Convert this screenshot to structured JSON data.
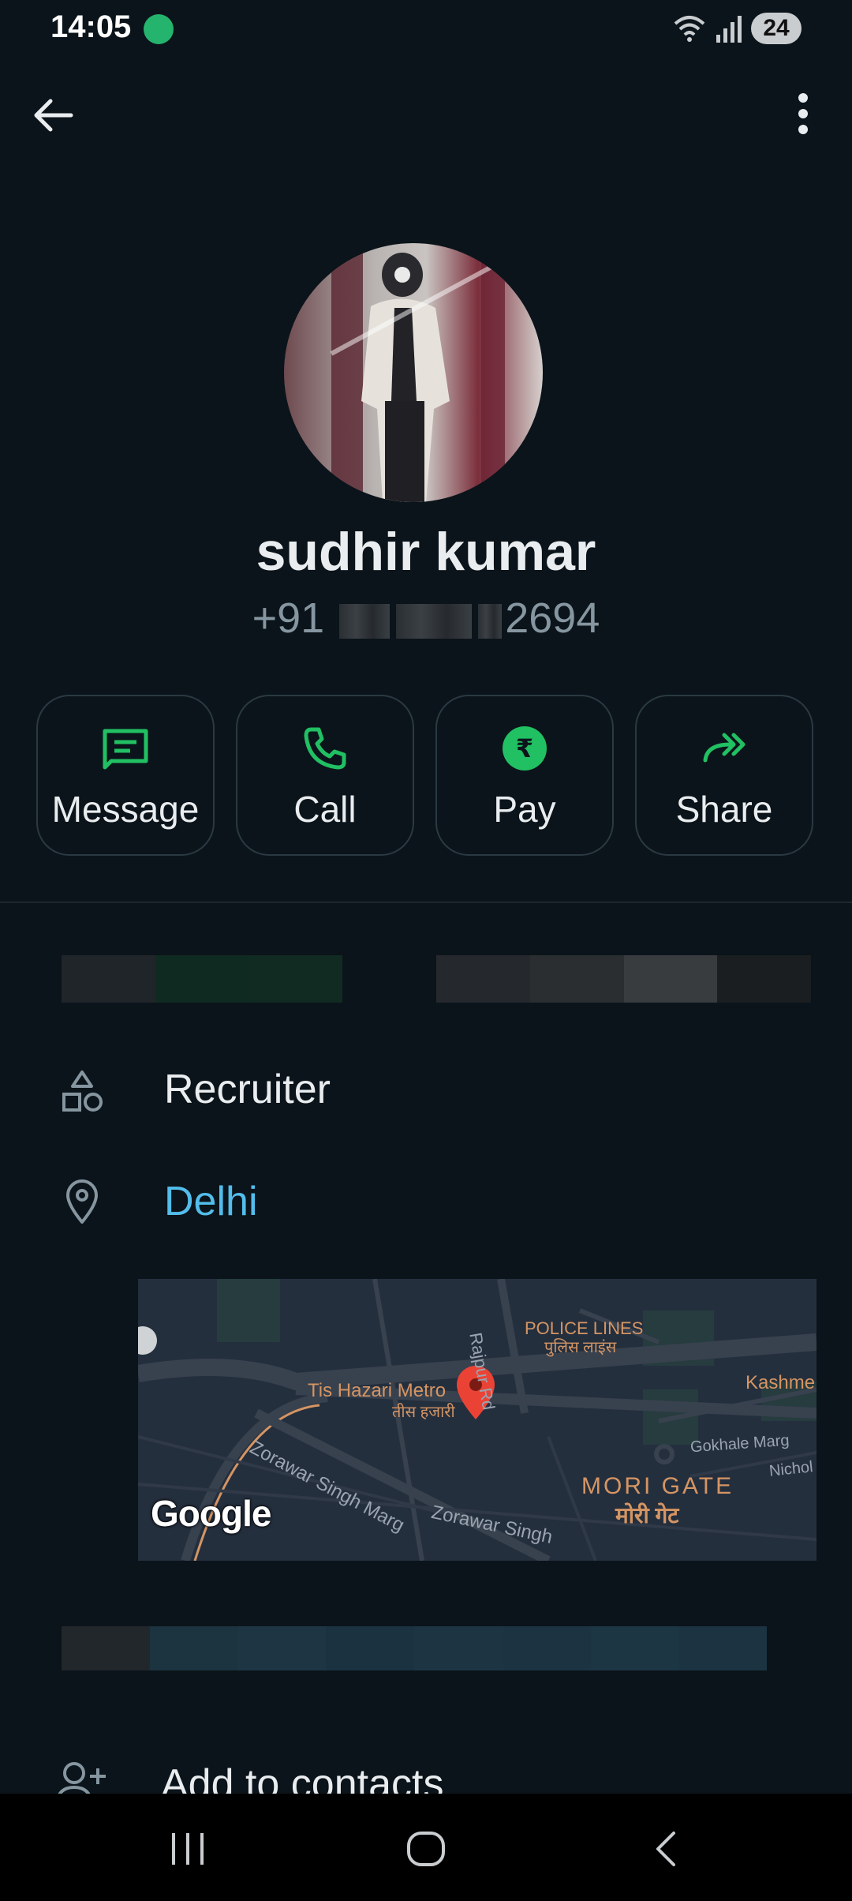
{
  "status_bar": {
    "time": "14:05",
    "battery": "24"
  },
  "contact": {
    "name": "sudhir kumar",
    "phone_prefix": "+91",
    "phone_suffix": "2694"
  },
  "actions": [
    {
      "label": "Message",
      "icon": "message-icon"
    },
    {
      "label": "Call",
      "icon": "phone-icon"
    },
    {
      "label": "Pay",
      "icon": "rupee-icon"
    },
    {
      "label": "Share",
      "icon": "share-icon"
    }
  ],
  "info": {
    "business_category": "Recruiter",
    "location": "Delhi"
  },
  "map": {
    "logo": "Google",
    "labels": [
      "POLICE LINES",
      "पुलिस लाइंस",
      "Tis Hazari Metro",
      "तीस हजारी",
      "Kashme",
      "Gokhale Marg",
      "MORI GATE",
      "मोरी गेट",
      "Nichol"
    ],
    "roads": [
      "Rajpur Rd",
      "Zorawar Singh Marg",
      "Zorawar Singh"
    ]
  },
  "add_contact_label": "Add to contacts",
  "colors": {
    "accent_green": "#21c063",
    "link_blue": "#53bdeb",
    "background": "#0b141a"
  }
}
